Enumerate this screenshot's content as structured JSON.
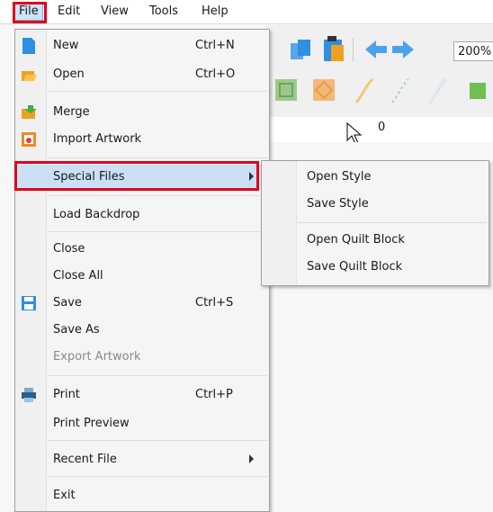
{
  "menubar": {
    "items": [
      {
        "label": "File"
      },
      {
        "label": "Edit"
      },
      {
        "label": "View"
      },
      {
        "label": "Tools"
      },
      {
        "label": "Help"
      }
    ]
  },
  "toolbar": {
    "zoom": "200%",
    "ruler_zero": "0"
  },
  "file_menu": {
    "items": [
      {
        "label": "New",
        "shortcut": "Ctrl+N",
        "icon": "new-file-icon"
      },
      {
        "label": "Open",
        "shortcut": "Ctrl+O",
        "icon": "open-folder-icon"
      },
      {
        "label": "Merge",
        "icon": "merge-folder-icon"
      },
      {
        "label": "Import Artwork",
        "icon": "import-artwork-icon"
      },
      {
        "label": "Special Files"
      },
      {
        "label": "Load Backdrop"
      },
      {
        "label": "Close"
      },
      {
        "label": "Close All"
      },
      {
        "label": "Save",
        "shortcut": "Ctrl+S",
        "icon": "save-icon"
      },
      {
        "label": "Save As"
      },
      {
        "label": "Export Artwork",
        "disabled": true
      },
      {
        "label": "Print",
        "shortcut": "Ctrl+P",
        "icon": "printer-icon"
      },
      {
        "label": "Print Preview"
      },
      {
        "label": "Recent File"
      },
      {
        "label": "Exit"
      }
    ]
  },
  "special_files_submenu": {
    "items": [
      {
        "label": "Open Style"
      },
      {
        "label": "Save Style"
      },
      {
        "label": "Open Quilt Block"
      },
      {
        "label": "Save Quilt Block"
      }
    ]
  },
  "colors": {
    "highlight": "#cce0f5",
    "annotation": "#e0001a",
    "icon_blue": "#2f8fe0"
  }
}
